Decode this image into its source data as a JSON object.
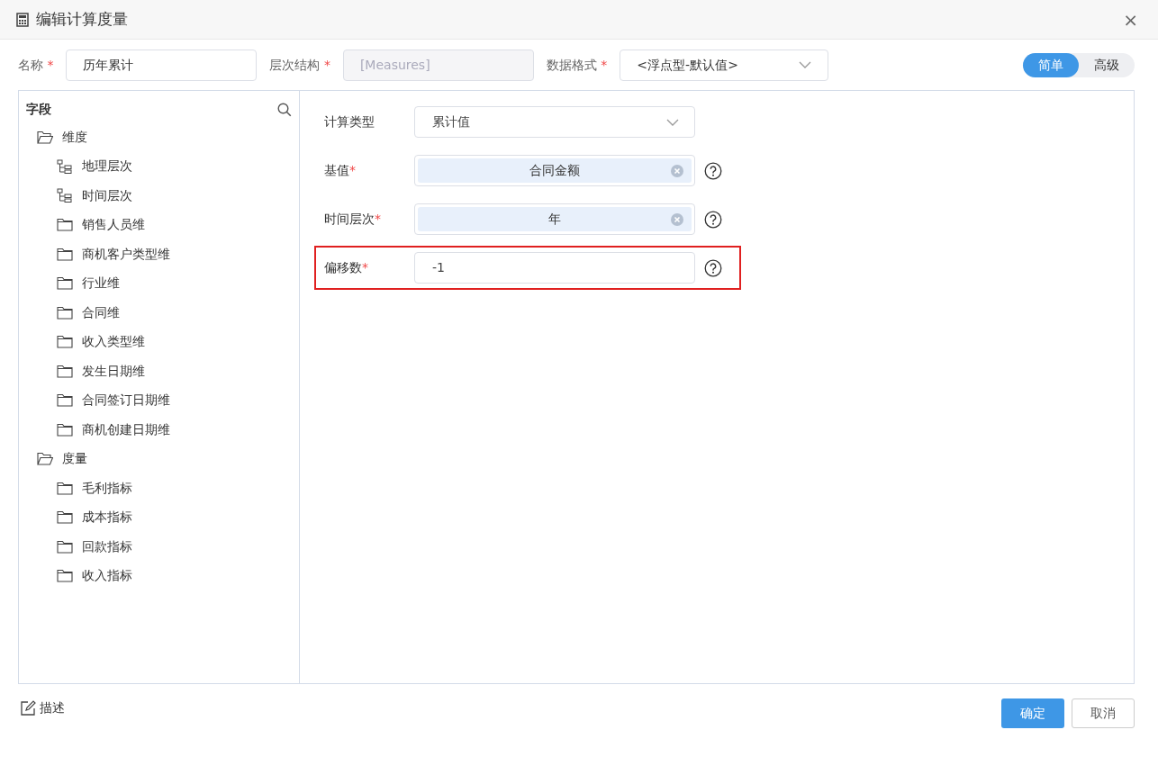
{
  "window": {
    "title": "编辑计算度量",
    "close": "×"
  },
  "top_fields": [
    {
      "label": "名称",
      "required_mark": "*",
      "kind": "text",
      "value": "历年累计",
      "disabled": false
    },
    {
      "label": "层次结构",
      "required_mark": "*",
      "kind": "text",
      "value": "[Measures]",
      "disabled": true
    },
    {
      "label": "数据格式",
      "required_mark": "*",
      "kind": "select",
      "value": "<浮点型-默认值>",
      "disabled": false
    }
  ],
  "mode_toggle": [
    {
      "label": "简单",
      "selected": true
    },
    {
      "label": "高级",
      "selected": false
    }
  ],
  "fields_panel": {
    "title": "字段",
    "tree": [
      {
        "label": "维度",
        "kind": "folder",
        "expanded": true,
        "children": [
          {
            "label": "地理层次",
            "kind": "hierarchy"
          },
          {
            "label": "时间层次",
            "kind": "hierarchy"
          },
          {
            "label": "销售人员维",
            "kind": "folder",
            "expanded": false
          },
          {
            "label": "商机客户类型维",
            "kind": "folder",
            "expanded": false
          },
          {
            "label": "行业维",
            "kind": "folder",
            "expanded": false
          },
          {
            "label": "合同维",
            "kind": "folder",
            "expanded": false
          },
          {
            "label": "收入类型维",
            "kind": "folder",
            "expanded": false
          },
          {
            "label": "发生日期维",
            "kind": "folder",
            "expanded": false
          },
          {
            "label": "合同签订日期维",
            "kind": "folder",
            "expanded": false
          },
          {
            "label": "商机创建日期维",
            "kind": "folder",
            "expanded": false
          }
        ]
      },
      {
        "label": "度量",
        "kind": "folder",
        "expanded": true,
        "children": [
          {
            "label": "毛利指标",
            "kind": "folder",
            "expanded": false
          },
          {
            "label": "成本指标",
            "kind": "folder",
            "expanded": false
          },
          {
            "label": "回款指标",
            "kind": "folder",
            "expanded": false
          },
          {
            "label": "收入指标",
            "kind": "folder",
            "expanded": false
          }
        ]
      }
    ]
  },
  "form": [
    {
      "label": "计算类型",
      "kind": "select",
      "value": "累计值",
      "help": false,
      "highlighted": false
    },
    {
      "label": "基值",
      "required_mark": "*",
      "kind": "tag",
      "value": "合同金额",
      "help": true,
      "highlighted": false
    },
    {
      "label": "时间层次",
      "required_mark": "*",
      "kind": "tag",
      "value": "年",
      "help": true,
      "highlighted": false
    },
    {
      "label": "偏移数",
      "required_mark": "*",
      "kind": "text",
      "value": "-1",
      "help": true,
      "highlighted": true
    }
  ],
  "footer": {
    "describe": "描述",
    "buttons": [
      {
        "label": "确定",
        "kind": "primary"
      },
      {
        "label": "取消",
        "kind": "secondary"
      }
    ]
  }
}
